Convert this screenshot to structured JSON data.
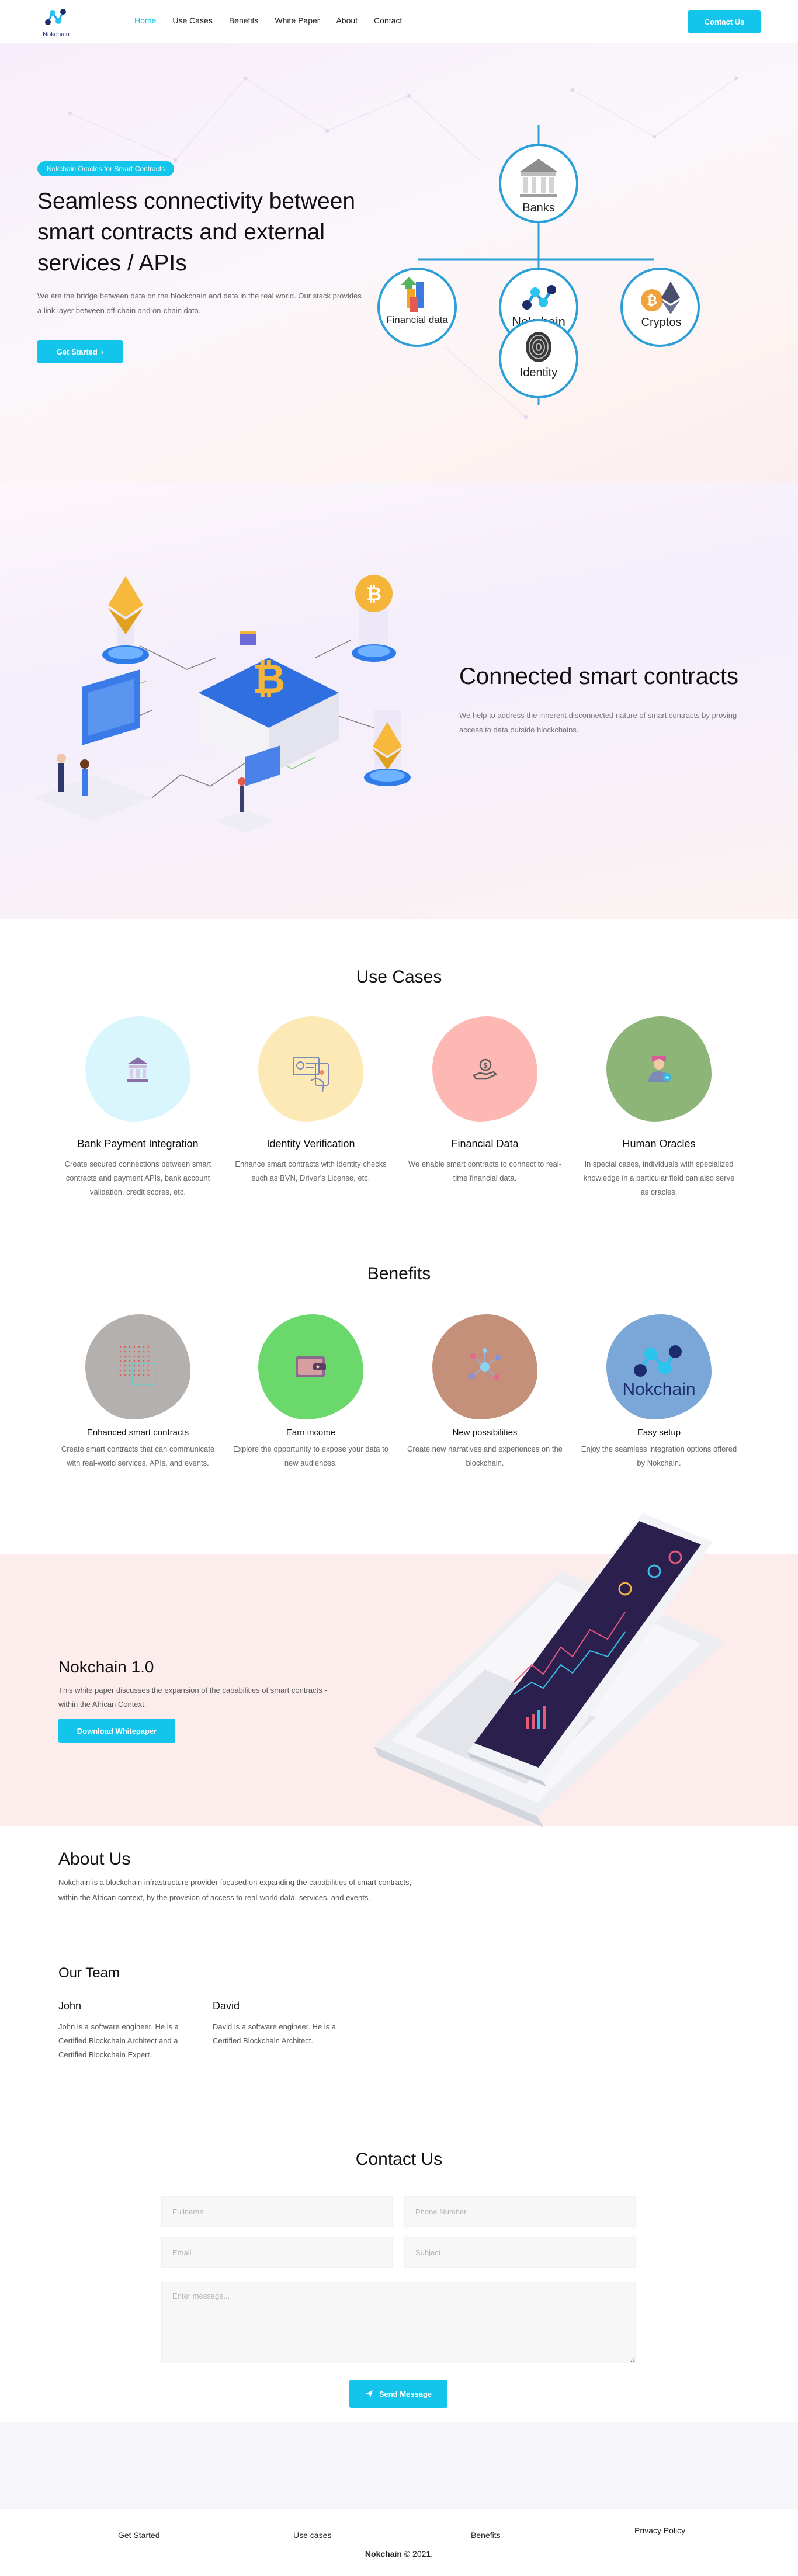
{
  "header": {
    "logo_text": "Nokchain",
    "nav": [
      "Home",
      "Use Cases",
      "Benefits",
      "White Paper",
      "About",
      "Contact"
    ],
    "cta": "Contact Us"
  },
  "hero": {
    "badge": "Nokchain Oracles for Smart Contracts",
    "title": "Seamless connectivity between smart contracts and external services / APIs",
    "description": "We are the bridge between data on the blockchain and data in the real world. Our stack provides a link layer between off-chain and on-chain data.",
    "cta": "Get Started",
    "diagram": {
      "center": "Nokchain",
      "nodes": [
        "Banks",
        "Financial data",
        "Cryptos",
        "Identity"
      ]
    }
  },
  "connected": {
    "title": "Connected smart contracts",
    "description": "We help to address the inherent disconnected nature of smart contracts by proving access to data outside blockchains."
  },
  "use_cases": {
    "title": "Use Cases",
    "items": [
      {
        "title": "Bank Payment Integration",
        "text": "Create secured connections between smart contracts and payment APIs, bank account validation, credit scores, etc.",
        "color": "#d9f6fc",
        "icon": "bank-icon"
      },
      {
        "title": "Identity Verification",
        "text": "Enhance smart contracts with identity checks such as BVN, Driver's License, etc.",
        "color": "#fde9b5",
        "icon": "identity-icon"
      },
      {
        "title": "Financial Data",
        "text": "We enable smart contracts to connect to real-time financial data.",
        "color": "#fdb8b3",
        "icon": "money-hand-icon"
      },
      {
        "title": "Human Oracles",
        "text": "In special cases, individuals with specialized knowledge in a particular field can also serve as oracles.",
        "color": "#8db577",
        "icon": "person-icon"
      }
    ]
  },
  "benefits": {
    "title": "Benefits",
    "items": [
      {
        "title": "Enhanced smart contracts",
        "text": "Create smart contracts that can communicate with real-world services, APIs, and events.",
        "color": "#b4b0ad",
        "icon": "grid-icon"
      },
      {
        "title": "Earn income",
        "text": "Explore the opportunity to expose your data to new audiences.",
        "color": "#6bd86b",
        "icon": "wallet-icon"
      },
      {
        "title": "New possibilities",
        "text": "Create new narratives and experiences on the blockchain.",
        "color": "#c4907a",
        "icon": "network-icon"
      },
      {
        "title": "Easy setup",
        "text": "Enjoy the seamless integration options offered by Nokchain.",
        "color": "#7aa7d8",
        "icon": "nokchain-logo",
        "logo_text": "Nokchain"
      }
    ]
  },
  "whitepaper": {
    "title": "Nokchain 1.0",
    "description": "This white paper discusses the expansion of the capabilities of smart contracts - within the African Context.",
    "cta": "Download Whitepaper"
  },
  "about": {
    "title": "About Us",
    "description": "Nokchain is a blockchain infrastructure provider focused on expanding the capabilities of smart contracts, within the African context, by the provision of access to real-world data, services, and events."
  },
  "team": {
    "title": "Our Team",
    "members": [
      {
        "name": "John",
        "bio": "John is a software engineer. He is a Certified Blockchain Architect and a Certified Blockchain Expert."
      },
      {
        "name": "David",
        "bio": "David is a software engineer. He is a Certified Blockchain Architect."
      }
    ]
  },
  "contact": {
    "title": "Contact Us",
    "placeholders": {
      "fullname": "Fullname",
      "phone": "Phone Number",
      "email": "Email",
      "subject": "Subject",
      "message": "Enter message..."
    },
    "submit": "Send Message"
  },
  "footer": {
    "links": [
      "Get Started",
      "Use cases",
      "Benefits",
      "Privacy Policy"
    ],
    "brand": "Nokchain",
    "copyright": "© 2021."
  },
  "colors": {
    "accent": "#13c5ea",
    "network_blue": "#2d9fd8",
    "whitepaper_bg": "#fcecec"
  }
}
